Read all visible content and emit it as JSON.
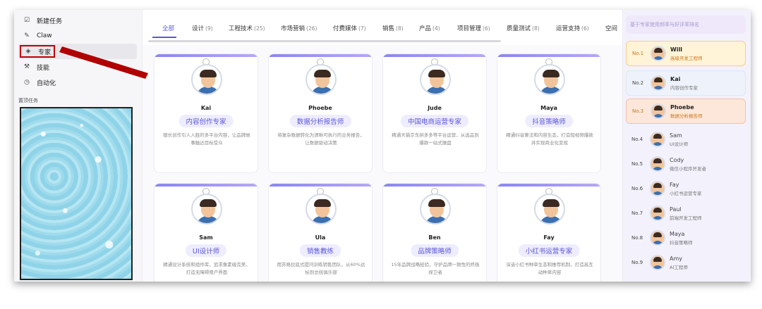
{
  "sidebar": {
    "items": [
      {
        "label": "新建任务",
        "icon": "edit-square-icon"
      },
      {
        "label": "Claw",
        "icon": "claw-icon"
      },
      {
        "label": "专家",
        "icon": "layers-icon"
      },
      {
        "label": "技能",
        "icon": "tools-icon"
      },
      {
        "label": "自动化",
        "icon": "clock-icon"
      }
    ],
    "pinned_label": "置顶任务"
  },
  "tabs": [
    {
      "label": "全部",
      "count": ""
    },
    {
      "label": "设计",
      "count": "(9)"
    },
    {
      "label": "工程技术",
      "count": "(25)"
    },
    {
      "label": "市场营销",
      "count": "(26)"
    },
    {
      "label": "付费媒体",
      "count": "(7)"
    },
    {
      "label": "销售",
      "count": "(8)"
    },
    {
      "label": "产品",
      "count": "(4)"
    },
    {
      "label": "项目管理",
      "count": "(6)"
    },
    {
      "label": "质量测试",
      "count": "(8)"
    },
    {
      "label": "运营支持",
      "count": "(6)"
    },
    {
      "label": "空间",
      "count": ""
    }
  ],
  "cards": [
    {
      "name": "Kai",
      "role": "内容创作专家",
      "desc": "擅长创作引人入胜的多平台内容，让品牌故事触达目标受众"
    },
    {
      "name": "Phoebe",
      "role": "数据分析报告师",
      "desc": "将复杂数据转化为清晰可执行的业务报告，让数据驱动决策"
    },
    {
      "name": "Jude",
      "role": "中国电商运营专家",
      "desc": "精通天猫京东拼多多等平台运营，从选品到爆款一站式操盘"
    },
    {
      "name": "Maya",
      "role": "抖音策略师",
      "desc": "精通抖音算法和内容生态，打造短视频爆款并实现商业化变现"
    },
    {
      "name": "Sam",
      "role": "UI设计师",
      "desc": "精通设计系统和组件库，追求像素级完美，打造无障碍用户界面"
    },
    {
      "name": "Ula",
      "role": "销售教练",
      "desc": "用苏格拉底式提问训练销售团队，从60%达标到总统俱乐部"
    },
    {
      "name": "Ben",
      "role": "品牌策略师",
      "desc": "15年品牌战略经验，守护品牌一致性的终极捍卫者"
    },
    {
      "name": "Fay",
      "role": "小红书运营专家",
      "desc": "深谙小红书种草生态和推荐机制，打造高互动种草内容"
    }
  ],
  "board": {
    "hint": "基于专家使用频率与好评率排名",
    "ranks": [
      {
        "no": "No.1",
        "name": "Will",
        "role": "高级开发工程师"
      },
      {
        "no": "No.2",
        "name": "Kai",
        "role": "内容创作专家"
      },
      {
        "no": "No.3",
        "name": "Phoebe",
        "role": "数据分析报告师"
      },
      {
        "no": "No.4",
        "name": "Sam",
        "role": "UI设计师"
      },
      {
        "no": "No.5",
        "name": "Cody",
        "role": "微信小程序开发者"
      },
      {
        "no": "No.6",
        "name": "Fay",
        "role": "小红书运营专家"
      },
      {
        "no": "No.7",
        "name": "Paul",
        "role": "前端开发工程师"
      },
      {
        "no": "No.8",
        "name": "Maya",
        "role": "抖音策略师"
      },
      {
        "no": "No.9",
        "name": "Amy",
        "role": "AI工程师"
      }
    ]
  },
  "colors": {
    "accent": "#5b57d6",
    "callout": "#c00000"
  }
}
